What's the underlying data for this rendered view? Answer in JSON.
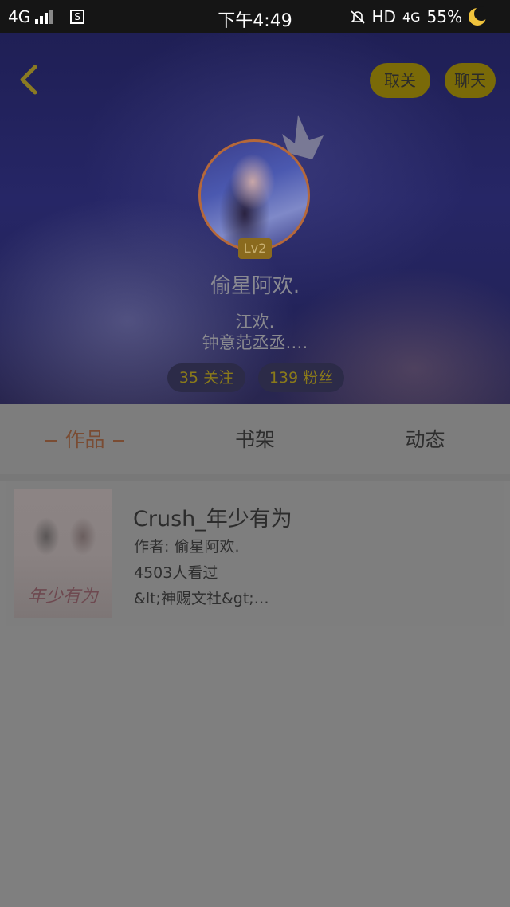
{
  "status_bar": {
    "network": "4G",
    "sim_icon": "S",
    "time": "下午4:49",
    "hd": "HD",
    "network_right": "4G",
    "battery": "55%"
  },
  "header": {
    "unfollow_label": "取关",
    "chat_label": "聊天",
    "level": "Lv2",
    "username": "偷星阿欢.",
    "bio_line1": "江欢.",
    "bio_line2": "钟意范丞丞.…",
    "following": "35 关注",
    "fans": "139 粉丝"
  },
  "tabs": [
    {
      "label": "作品",
      "active": true
    },
    {
      "label": "书架",
      "active": false
    },
    {
      "label": "动态",
      "active": false
    }
  ],
  "works": [
    {
      "title": "Crush_年少有为",
      "author": "作者: 偷星阿欢.",
      "views": "4503人看过",
      "tag": "&lt;神赐文社&gt;…",
      "cover_text": "年少有为"
    }
  ],
  "colors": {
    "accent": "#7a4c33",
    "pill": "#7a6a08",
    "header_bg": "#23235a"
  }
}
